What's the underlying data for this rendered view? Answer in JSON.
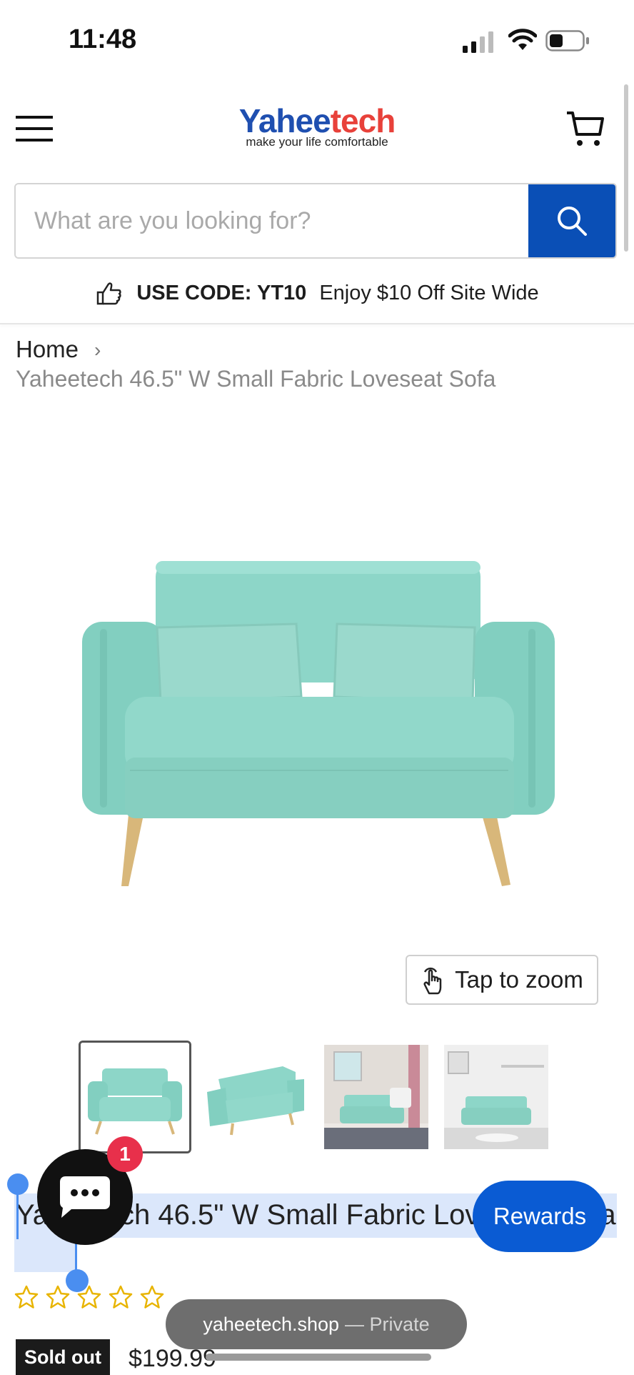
{
  "status_bar": {
    "time": "11:48"
  },
  "header": {
    "logo_main_a": "Yahee",
    "logo_main_b": "tech",
    "logo_tagline": "make your life comfortable"
  },
  "search": {
    "placeholder": "What are you looking for?"
  },
  "promo": {
    "code_label": "USE CODE: YT10",
    "text": "Enjoy $10 Off Site Wide"
  },
  "breadcrumb": {
    "home": "Home",
    "separator": "›",
    "current": "Yaheetech 46.5\" W Small Fabric Loveseat Sofa"
  },
  "gallery": {
    "zoom_label": "Tap to zoom",
    "thumbnails": [
      "sofa-front",
      "sofa-angle",
      "sofa-room-1",
      "sofa-room-2"
    ],
    "selected_index": 0
  },
  "product": {
    "title": "Yaheetech 46.5\" W Small Fabric Loveseat Sofa",
    "rating": 0,
    "max_rating": 5,
    "status": "Sold out",
    "price": "$199.99"
  },
  "chat": {
    "badge_count": "1"
  },
  "rewards": {
    "label": "Rewards"
  },
  "browser": {
    "domain": "yaheetech.shop",
    "mode": "— Private"
  },
  "colors": {
    "brand_blue": "#0a4fb6",
    "rewards_blue": "#0a5bd3",
    "sofa_teal": "#7fd3c4",
    "badge_red": "#e8304b"
  }
}
